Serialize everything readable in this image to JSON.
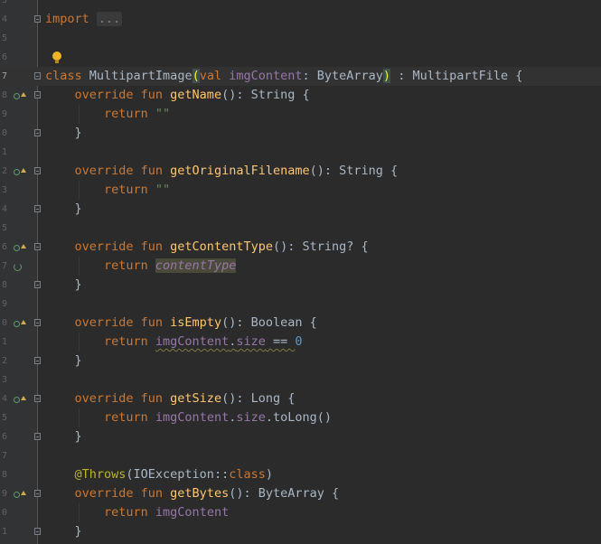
{
  "editor": {
    "lines": [
      {
        "ln": "3",
        "icons": [],
        "fold": false,
        "current": false,
        "indent": 0,
        "tokens": []
      },
      {
        "ln": "4",
        "icons": [],
        "fold": true,
        "current": false,
        "indent": 0,
        "tokens": [
          {
            "t": "import ",
            "c": "kw"
          },
          {
            "t": "...",
            "c": "folded"
          }
        ]
      },
      {
        "ln": "5",
        "icons": [],
        "fold": false,
        "current": false,
        "indent": 0,
        "tokens": []
      },
      {
        "ln": "6",
        "icons": [],
        "fold": false,
        "current": false,
        "indent": 0,
        "tokens": []
      },
      {
        "ln": "7",
        "icons": [],
        "fold": true,
        "current": true,
        "indent": 0,
        "tokens": [
          {
            "t": "class ",
            "c": "kw"
          },
          {
            "t": "MultipartImage",
            "c": ""
          },
          {
            "t": "(",
            "c": "paren-match"
          },
          {
            "t": "val ",
            "c": "kw"
          },
          {
            "t": "imgContent",
            "c": "prop"
          },
          {
            "t": ": ByteArray",
            "c": ""
          },
          {
            "t": ")",
            "c": "paren-match"
          },
          {
            "t": " : MultipartFile {",
            "c": ""
          }
        ]
      },
      {
        "ln": "8",
        "icons": [
          "override",
          "up"
        ],
        "fold": true,
        "current": false,
        "indent": 1,
        "tokens": [
          {
            "t": "override fun ",
            "c": "kw"
          },
          {
            "t": "getName",
            "c": "fn"
          },
          {
            "t": "(): String {",
            "c": ""
          }
        ]
      },
      {
        "ln": "9",
        "icons": [],
        "fold": false,
        "current": false,
        "indent": 2,
        "tokens": [
          {
            "t": "return ",
            "c": "kw"
          },
          {
            "t": "\"\"",
            "c": "str"
          }
        ]
      },
      {
        "ln": "0",
        "icons": [],
        "fold": true,
        "current": false,
        "indent": 1,
        "tokens": [
          {
            "t": "}",
            "c": ""
          }
        ]
      },
      {
        "ln": "1",
        "icons": [],
        "fold": false,
        "current": false,
        "indent": 0,
        "tokens": []
      },
      {
        "ln": "2",
        "icons": [
          "override",
          "up"
        ],
        "fold": true,
        "current": false,
        "indent": 1,
        "tokens": [
          {
            "t": "override fun ",
            "c": "kw"
          },
          {
            "t": "getOriginalFilename",
            "c": "fn"
          },
          {
            "t": "(): String {",
            "c": ""
          }
        ]
      },
      {
        "ln": "3",
        "icons": [],
        "fold": false,
        "current": false,
        "indent": 2,
        "tokens": [
          {
            "t": "return ",
            "c": "kw"
          },
          {
            "t": "\"\"",
            "c": "str"
          }
        ]
      },
      {
        "ln": "4",
        "icons": [],
        "fold": true,
        "current": false,
        "indent": 1,
        "tokens": [
          {
            "t": "}",
            "c": ""
          }
        ]
      },
      {
        "ln": "5",
        "icons": [],
        "fold": false,
        "current": false,
        "indent": 0,
        "tokens": []
      },
      {
        "ln": "6",
        "icons": [
          "override",
          "up"
        ],
        "fold": true,
        "current": false,
        "indent": 1,
        "tokens": [
          {
            "t": "override fun ",
            "c": "kw"
          },
          {
            "t": "getContentType",
            "c": "fn"
          },
          {
            "t": "(): String? {",
            "c": ""
          }
        ]
      },
      {
        "ln": "7",
        "icons": [
          "recursive"
        ],
        "fold": false,
        "current": false,
        "indent": 2,
        "tokens": [
          {
            "t": "return ",
            "c": "kw"
          },
          {
            "t": "contentType",
            "c": "prop ital ct-highlight"
          }
        ]
      },
      {
        "ln": "8",
        "icons": [],
        "fold": true,
        "current": false,
        "indent": 1,
        "tokens": [
          {
            "t": "}",
            "c": ""
          }
        ]
      },
      {
        "ln": "9",
        "icons": [],
        "fold": false,
        "current": false,
        "indent": 0,
        "tokens": []
      },
      {
        "ln": "0",
        "icons": [
          "override",
          "up"
        ],
        "fold": true,
        "current": false,
        "indent": 1,
        "tokens": [
          {
            "t": "override fun ",
            "c": "kw"
          },
          {
            "t": "isEmpty",
            "c": "fn"
          },
          {
            "t": "(): Boolean {",
            "c": ""
          }
        ]
      },
      {
        "ln": "1",
        "icons": [],
        "fold": false,
        "current": false,
        "indent": 2,
        "tokens": [
          {
            "t": "return ",
            "c": "kw"
          },
          {
            "t": "imgContent",
            "c": "prop squiggle"
          },
          {
            "t": ".",
            "c": "squiggle"
          },
          {
            "t": "size",
            "c": "prop squiggle"
          },
          {
            "t": " == ",
            "c": "squiggle"
          },
          {
            "t": "0",
            "c": "num"
          }
        ]
      },
      {
        "ln": "2",
        "icons": [],
        "fold": true,
        "current": false,
        "indent": 1,
        "tokens": [
          {
            "t": "}",
            "c": ""
          }
        ]
      },
      {
        "ln": "3",
        "icons": [],
        "fold": false,
        "current": false,
        "indent": 0,
        "tokens": []
      },
      {
        "ln": "4",
        "icons": [
          "override",
          "up"
        ],
        "fold": true,
        "current": false,
        "indent": 1,
        "tokens": [
          {
            "t": "override fun ",
            "c": "kw"
          },
          {
            "t": "getSize",
            "c": "fn"
          },
          {
            "t": "(): Long {",
            "c": ""
          }
        ]
      },
      {
        "ln": "5",
        "icons": [],
        "fold": false,
        "current": false,
        "indent": 2,
        "tokens": [
          {
            "t": "return ",
            "c": "kw"
          },
          {
            "t": "imgContent",
            "c": "prop"
          },
          {
            "t": ".",
            "c": ""
          },
          {
            "t": "size",
            "c": "prop"
          },
          {
            "t": ".toLong()",
            "c": ""
          }
        ]
      },
      {
        "ln": "6",
        "icons": [],
        "fold": true,
        "current": false,
        "indent": 1,
        "tokens": [
          {
            "t": "}",
            "c": ""
          }
        ]
      },
      {
        "ln": "7",
        "icons": [],
        "fold": false,
        "current": false,
        "indent": 0,
        "tokens": []
      },
      {
        "ln": "8",
        "icons": [],
        "fold": false,
        "current": false,
        "indent": 1,
        "tokens": [
          {
            "t": "@Throws",
            "c": "ann"
          },
          {
            "t": "(IOException::",
            "c": ""
          },
          {
            "t": "class",
            "c": "kw"
          },
          {
            "t": ")",
            "c": ""
          }
        ]
      },
      {
        "ln": "9",
        "icons": [
          "override",
          "up"
        ],
        "fold": true,
        "current": false,
        "indent": 1,
        "tokens": [
          {
            "t": "override fun ",
            "c": "kw"
          },
          {
            "t": "getBytes",
            "c": "fn"
          },
          {
            "t": "(): ByteArray {",
            "c": ""
          }
        ]
      },
      {
        "ln": "0",
        "icons": [],
        "fold": false,
        "current": false,
        "indent": 2,
        "tokens": [
          {
            "t": "return ",
            "c": "kw"
          },
          {
            "t": "imgContent",
            "c": "prop"
          }
        ]
      },
      {
        "ln": "1",
        "icons": [],
        "fold": true,
        "current": false,
        "indent": 1,
        "tokens": [
          {
            "t": "}",
            "c": ""
          }
        ]
      }
    ]
  },
  "icons": {
    "override": "override-method-icon",
    "up": "go-to-super-icon",
    "recursive": "recursive-call-icon",
    "bulb": "intention-bulb-icon"
  },
  "colors": {
    "background": "#2b2b2b",
    "gutter": "#313335",
    "keyword": "#cc7832",
    "function": "#ffc66d",
    "string": "#6a8759",
    "property": "#9876aa",
    "number": "#6897bb",
    "annotation": "#bbb529",
    "text": "#a9b7c6"
  }
}
